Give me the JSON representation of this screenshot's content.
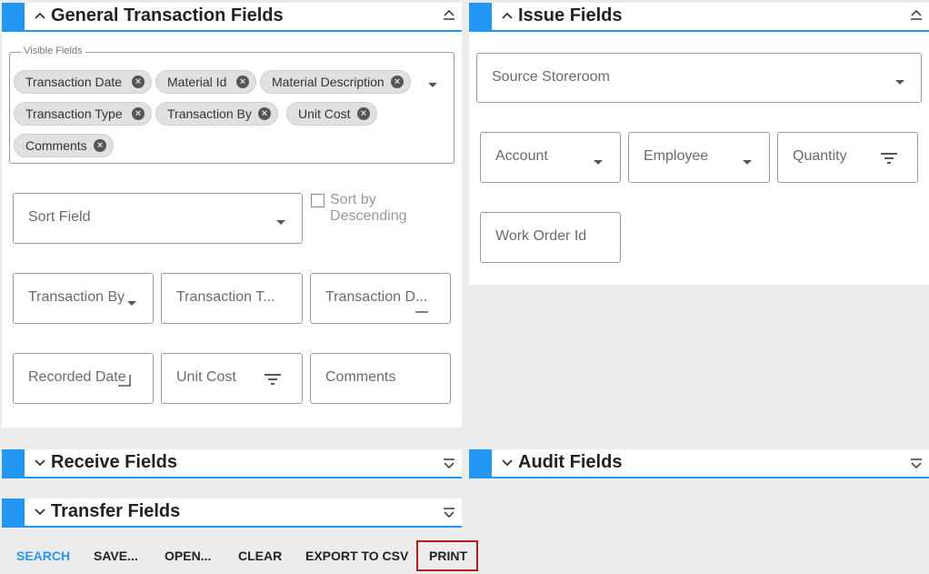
{
  "general": {
    "title": "General Transaction Fields",
    "visible_fields_legend": "Visible Fields",
    "chips": [
      "Transaction Date",
      "Material Id",
      "Material Description",
      "Transaction Type",
      "Transaction By",
      "Unit Cost",
      "Comments"
    ],
    "sort_field": "Sort Field",
    "sort_desc_line1": "Sort by",
    "sort_desc_line2": "Descending",
    "transaction_by": "Transaction By",
    "transaction_type": "Transaction T...",
    "transaction_date": "Transaction D...",
    "recorded_date": "Recorded Date",
    "unit_cost": "Unit Cost",
    "comments": "Comments"
  },
  "issue": {
    "title": "Issue Fields",
    "source_storeroom": "Source Storeroom",
    "account": "Account",
    "employee": "Employee",
    "quantity": "Quantity",
    "work_order_id": "Work Order Id"
  },
  "receive": {
    "title": "Receive Fields"
  },
  "audit": {
    "title": "Audit Fields"
  },
  "transfer": {
    "title": "Transfer Fields"
  },
  "actions": {
    "search": "SEARCH",
    "save": "SAVE...",
    "open": "OPEN...",
    "clear": "CLEAR",
    "export": "EXPORT TO CSV",
    "print": "PRINT"
  },
  "colors": {
    "accent": "#2196f3",
    "search": "#2196f3",
    "print_border": "#b71c1c"
  }
}
